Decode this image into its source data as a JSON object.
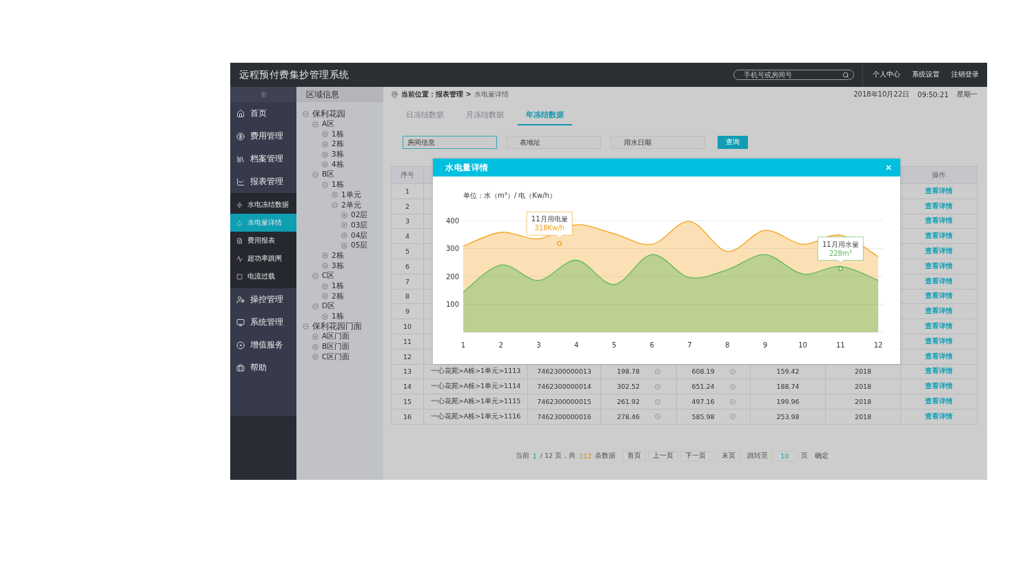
{
  "header": {
    "title": "远程预付费集抄管理系统",
    "search": {
      "placeholder": "手机号或房间号"
    },
    "links": [
      "个人中心",
      "系统设置",
      "注销登录"
    ]
  },
  "sidebar": {
    "items": [
      {
        "label": "首页",
        "selected": false
      },
      {
        "label": "费用管理",
        "selected": false
      },
      {
        "label": "档案管理",
        "selected": false
      },
      {
        "label": "报表管理",
        "selected": false,
        "expanded": true,
        "children": [
          {
            "label": "水电冻结数据",
            "selected": false
          },
          {
            "label": "水电量详情",
            "selected": true
          },
          {
            "label": "费用报表",
            "selected": false
          },
          {
            "label": "超功率跳闸",
            "selected": false
          },
          {
            "label": "电流过载",
            "selected": false
          }
        ]
      },
      {
        "label": "操控管理",
        "selected": false
      },
      {
        "label": "系统管理",
        "selected": false
      },
      {
        "label": "增值服务",
        "selected": false
      },
      {
        "label": "帮助",
        "selected": false
      }
    ]
  },
  "tree": {
    "title": "区域信息",
    "nodes": [
      {
        "label": "保利花园",
        "expanded": true,
        "children": [
          {
            "label": "A区",
            "expanded": true,
            "children": [
              {
                "label": "1栋",
                "expanded": false
              },
              {
                "label": "2栋",
                "expanded": false
              },
              {
                "label": "3栋",
                "expanded": false
              },
              {
                "label": "4栋",
                "expanded": false
              }
            ]
          },
          {
            "label": "B区",
            "expanded": true,
            "children": [
              {
                "label": "1栋",
                "expanded": true,
                "children": [
                  {
                    "label": "1单元",
                    "expanded": false
                  },
                  {
                    "label": "2单元",
                    "expanded": true,
                    "children": [
                      {
                        "label": "02层",
                        "expanded": false
                      },
                      {
                        "label": "03层",
                        "expanded": false
                      },
                      {
                        "label": "04层",
                        "expanded": false
                      },
                      {
                        "label": "05层",
                        "expanded": false
                      }
                    ]
                  }
                ]
              },
              {
                "label": "2栋",
                "expanded": false
              },
              {
                "label": "3栋",
                "expanded": false
              }
            ]
          },
          {
            "label": "C区",
            "expanded": true,
            "children": [
              {
                "label": "1栋",
                "expanded": false
              },
              {
                "label": "2栋",
                "expanded": false
              }
            ]
          },
          {
            "label": "D区",
            "expanded": true,
            "children": [
              {
                "label": "1栋",
                "expanded": false
              }
            ]
          }
        ]
      },
      {
        "label": "保利花园门面",
        "expanded": true,
        "children": [
          {
            "label": "A区门面",
            "expanded": false
          },
          {
            "label": "B区门面",
            "expanded": false
          },
          {
            "label": "C区门面",
            "expanded": false
          }
        ]
      }
    ]
  },
  "breadcrumb": {
    "prefix": "当前位置：报表管理 >",
    "current": "水电量详情"
  },
  "datetime": {
    "date": "2018年10月22日",
    "time": "09:50:21",
    "weekday": "星期一"
  },
  "tabs": [
    {
      "label": "日冻结数据",
      "selected": false
    },
    {
      "label": "月冻结数据",
      "selected": false
    },
    {
      "label": "年冻结数据",
      "selected": true
    }
  ],
  "filters": [
    {
      "placeholder": "房间信息",
      "focused": true
    },
    {
      "placeholder": "表地址",
      "focused": false
    },
    {
      "placeholder": "用水日期",
      "focused": false
    }
  ],
  "query_button": "查询",
  "table": {
    "index_header": "序号",
    "action_header": "操作",
    "rows": [
      {
        "index": "1",
        "action": "查看详情"
      },
      {
        "index": "2",
        "action": "查看详情"
      },
      {
        "index": "3",
        "action": "查看详情"
      },
      {
        "index": "4",
        "action": "查看详情"
      },
      {
        "index": "5",
        "action": "查看详情"
      },
      {
        "index": "6",
        "action": "查看详情"
      },
      {
        "index": "7",
        "action": "查看详情"
      },
      {
        "index": "8",
        "action": "查看详情"
      },
      {
        "index": "9",
        "action": "查看详情"
      },
      {
        "index": "10",
        "action": "查看详情"
      },
      {
        "index": "11",
        "action": "查看详情"
      },
      {
        "index": "12",
        "action": "查看详情"
      },
      {
        "index": "13",
        "action": "查看详情",
        "cells": [
          {
            "text": "一心花苑>A栋>1单元>1113",
            "kind": "plain"
          },
          {
            "text": "7462300000013",
            "kind": "plain"
          },
          {
            "text": "198.78",
            "kind": "select"
          },
          {
            "text": "608.19",
            "kind": "select"
          },
          {
            "text": "159.42",
            "kind": "plain"
          },
          {
            "text": "2018",
            "kind": "plain"
          }
        ]
      },
      {
        "index": "14",
        "action": "查看详情",
        "cells": [
          {
            "text": "一心花苑>A栋>1单元>1114",
            "kind": "plain"
          },
          {
            "text": "7462300000014",
            "kind": "plain"
          },
          {
            "text": "302.52",
            "kind": "select"
          },
          {
            "text": "651.24",
            "kind": "select"
          },
          {
            "text": "188.74",
            "kind": "plain"
          },
          {
            "text": "2018",
            "kind": "plain"
          }
        ]
      },
      {
        "index": "15",
        "action": "查看详情",
        "cells": [
          {
            "text": "一心花苑>A栋>1单元>1115",
            "kind": "plain"
          },
          {
            "text": "7462300000015",
            "kind": "plain"
          },
          {
            "text": "261.92",
            "kind": "select"
          },
          {
            "text": "497.16",
            "kind": "select"
          },
          {
            "text": "199.96",
            "kind": "plain"
          },
          {
            "text": "2018",
            "kind": "plain"
          }
        ]
      },
      {
        "index": "16",
        "action": "查看详情",
        "cells": [
          {
            "text": "一心花苑>A栋>1单元>1116",
            "kind": "plain"
          },
          {
            "text": "7462300000016",
            "kind": "plain"
          },
          {
            "text": "278.46",
            "kind": "select"
          },
          {
            "text": "585.98",
            "kind": "select"
          },
          {
            "text": "253.98",
            "kind": "plain"
          },
          {
            "text": "2018",
            "kind": "plain"
          }
        ]
      }
    ]
  },
  "pagination": {
    "prefix": "当前",
    "current": "1",
    "middle": "/ 12 页，共",
    "total": "112",
    "suffix": "条数据",
    "buttons": [
      "首页",
      "上一页",
      "下一页",
      "末页"
    ],
    "jump_label": "跳转至",
    "jump_value": "10",
    "page_unit": "页",
    "confirm": "确定"
  },
  "modal": {
    "title": "水电量详情",
    "close": "×",
    "chart_data": {
      "type": "area",
      "ylabel": "单位：水（m³）/ 电（Kw/h）",
      "x": [
        1,
        2,
        3,
        4,
        5,
        6,
        7,
        8,
        9,
        10,
        11,
        12
      ],
      "xlim": [
        1,
        12
      ],
      "xticks": [
        1,
        2,
        3,
        4,
        5,
        6,
        7,
        8,
        9,
        10,
        11,
        12
      ],
      "yticks": [
        100,
        200,
        300,
        400
      ],
      "ylim": [
        0,
        400
      ],
      "grid": true,
      "series": [
        {
          "color": "#f5a01a",
          "values": [
            308,
            358,
            335,
            385,
            353,
            315,
            397,
            290,
            365,
            315,
            348,
            271
          ]
        },
        {
          "color": "#5cb85c",
          "values": [
            144,
            241,
            186,
            258,
            171,
            278,
            196,
            224,
            278,
            209,
            236,
            186
          ]
        }
      ],
      "annotations": [
        {
          "x": 3.55,
          "y": 318,
          "text": "11月用电量\n318Kw/h"
        },
        {
          "x": 11,
          "y": 228,
          "text": "11月用水量\n228m³"
        }
      ]
    }
  }
}
